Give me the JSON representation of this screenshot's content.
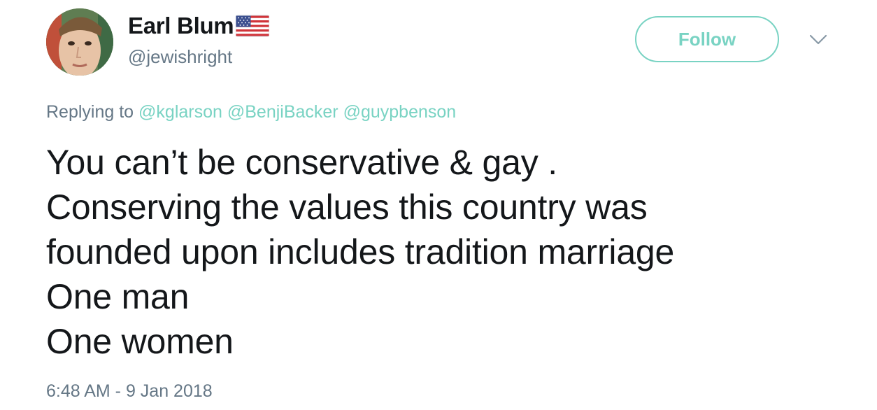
{
  "author": {
    "display_name": "Earl Blum",
    "handle": "@jewishright",
    "name_emoji": "us-flag-icon"
  },
  "follow_button": {
    "label": "Follow"
  },
  "menu": {
    "icon": "chevron-down-icon"
  },
  "reply": {
    "prefix": "Replying to",
    "mentions": [
      "@kglarson",
      "@BenjiBacker",
      "@guypbenson"
    ]
  },
  "tweet": {
    "text": "You can’t be conservative & gay .\nConserving the values this country was\nfounded upon includes tradition marriage\nOne man\nOne women"
  },
  "meta": {
    "timestamp": "6:48 AM - 9 Jan 2018"
  },
  "colors": {
    "accent": "#79d3c3",
    "secondary_text": "#657786",
    "primary_text": "#14171a"
  }
}
